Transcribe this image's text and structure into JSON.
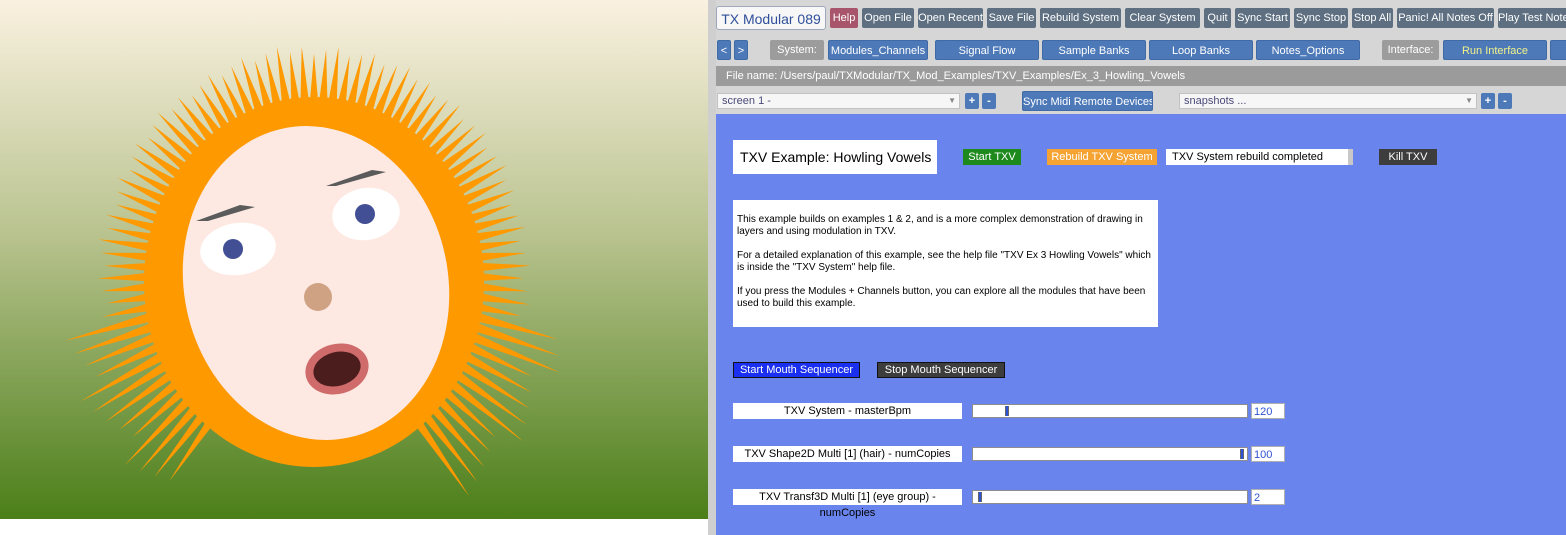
{
  "canvas": {
    "bg_top": "#faf1e0",
    "bg_bottom": "#4b7f19",
    "hair_color": "#ff9900",
    "face_color": "#fde8e2",
    "eye_white": "#ffffff",
    "pupil_color": "#424f94",
    "brow_color": "#5b5b5b",
    "nose_color": "#d0a284",
    "mouth_outer": "#cf6b6b",
    "mouth_inner": "#4b1d1d"
  },
  "toolbar": {
    "app_title": "TX Modular 089",
    "buttons": [
      "Help",
      "Open File",
      "Open Recent",
      "Save File",
      "Rebuild System",
      "Clear System",
      "Quit",
      "Sync Start",
      "Sync Stop",
      "Stop All",
      "Panic! All Notes Off",
      "Play Test Note"
    ]
  },
  "nav": {
    "prev": "<",
    "next": ">",
    "system_label": "System:",
    "system_buttons": [
      "Modules_Channels",
      "Signal Flow",
      "Sample Banks",
      "Loop Banks",
      "Notes_Options"
    ],
    "interface_label": "Interface:",
    "run_interface": "Run Interface"
  },
  "file": {
    "name_line": "File name: /Users/paul/TXModular/TX_Mod_Examples/TXV_Examples/Ex_3_Howling_Vowels"
  },
  "screen_row": {
    "screen_select": "screen 1 -",
    "plus": "+",
    "minus": "-",
    "sync_midi": "Sync Midi Remote Devices",
    "snapshots_select": "snapshots ..."
  },
  "panel": {
    "title": "TXV Example:  Howling Vowels",
    "start_txv": "Start TXV",
    "rebuild_txv": "Rebuild TXV System",
    "status": "TXV System rebuild completed",
    "kill_txv": "Kill TXV",
    "description": [
      "This example builds on examples 1 & 2,  and is a more complex demonstration of drawing in layers and using modulation in TXV.",
      "For a detailed explanation of this example, see the help file \"TXV Ex 3 Howling Vowels\" which is inside the \"TXV System\" help file.",
      "If you press the Modules + Channels button, you can explore all the modules that have been used to build this example."
    ],
    "start_mouth": "Start Mouth Sequencer",
    "stop_mouth": "Stop Mouth Sequencer",
    "sliders": [
      {
        "label": "TXV System - masterBpm",
        "value": "120",
        "fraction": 0.12
      },
      {
        "label": "TXV Shape2D Multi [1] (hair) - numCopies",
        "value": "100",
        "fraction": 0.99
      },
      {
        "label": "TXV Transf3D Multi [1] (eye group) - numCopies",
        "value": "2",
        "fraction": 0.02
      }
    ]
  }
}
